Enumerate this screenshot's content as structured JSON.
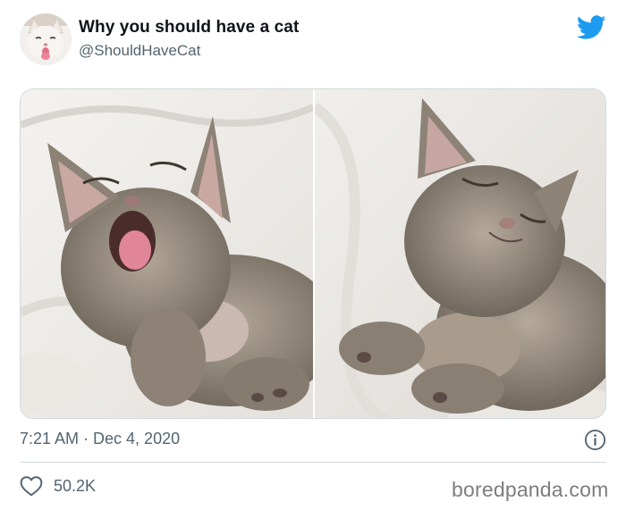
{
  "tweet": {
    "display_name": "Why you should have a cat",
    "handle": "@ShouldHaveCat",
    "timestamp": "7:21 AM · Dec 4, 2020",
    "likes": "50.2K"
  },
  "media": {
    "photos": [
      {
        "name": "yawning-kitten-photo"
      },
      {
        "name": "sleeping-kitten-photo"
      }
    ]
  },
  "icons": {
    "brand": "twitter-bird-icon",
    "info": "info-icon",
    "like": "heart-icon"
  },
  "colors": {
    "brand_blue": "#1d9bf0",
    "secondary_text": "#536471",
    "divider": "#cfd9de",
    "watermark": "#7d7d7d"
  },
  "watermark": "boredpanda.com"
}
